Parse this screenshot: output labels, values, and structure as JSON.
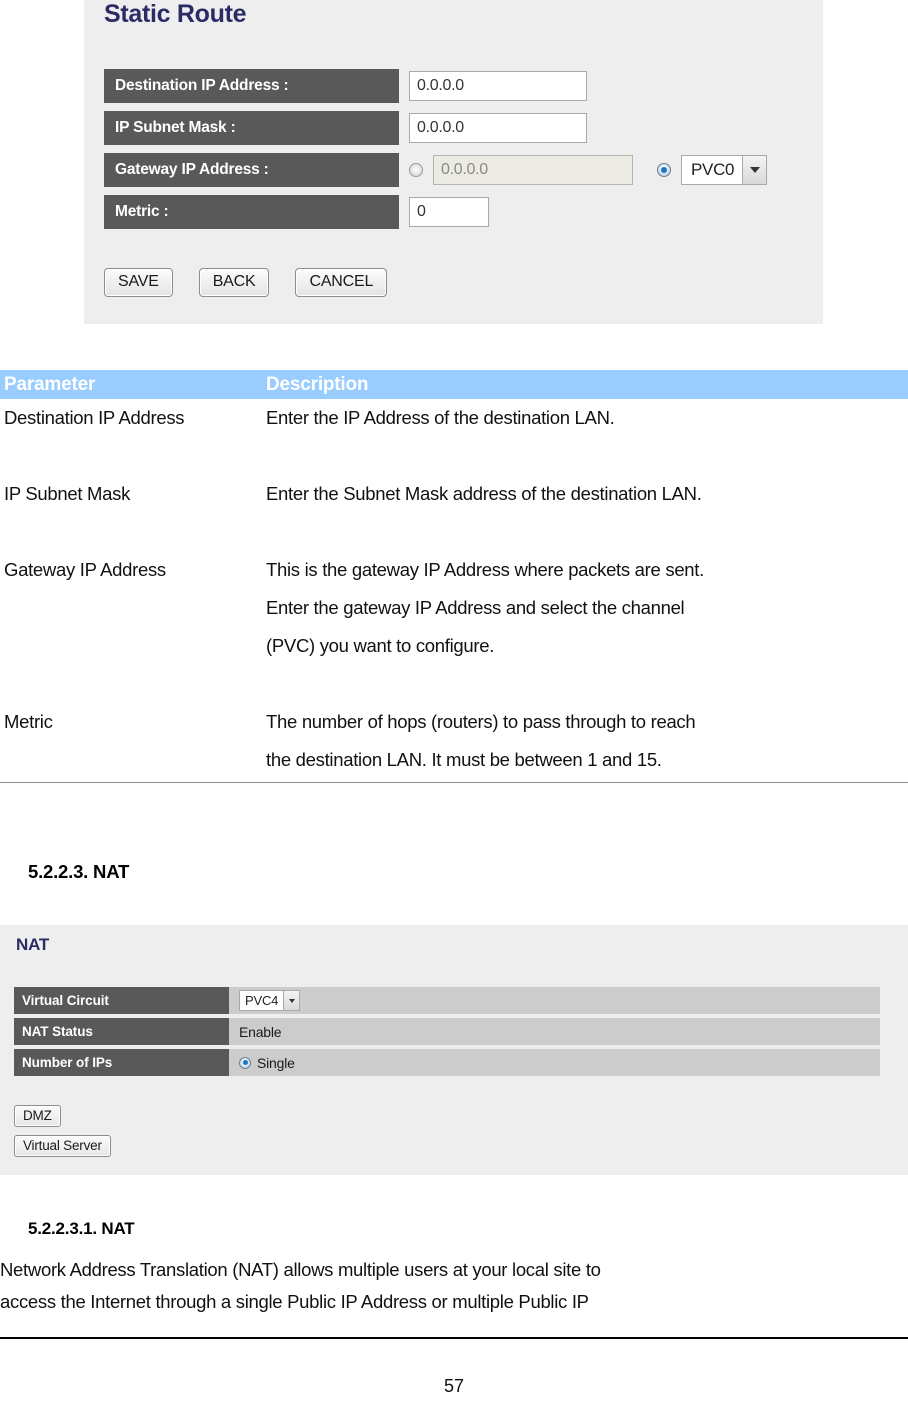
{
  "static_route_panel": {
    "title": "Static Route",
    "rows": [
      {
        "label": "Destination IP Address :",
        "value": "0.0.0.0"
      },
      {
        "label": "IP Subnet Mask :",
        "value": "0.0.0.0"
      },
      {
        "label": "Gateway IP Address :",
        "value": "0.0.0.0",
        "pvc_selected": "PVC0"
      },
      {
        "label": "Metric :",
        "value": "0"
      }
    ],
    "gateway_ip_radio_checked": false,
    "gateway_pvc_radio_checked": true,
    "buttons": [
      "SAVE",
      "BACK",
      "CANCEL"
    ]
  },
  "param_table": {
    "header": {
      "parameter": "Parameter",
      "description": "Description"
    },
    "rows": [
      {
        "parameter": "Destination IP Address",
        "description": [
          "Enter the IP Address of the destination LAN."
        ]
      },
      {
        "parameter": "IP Subnet Mask",
        "description": [
          "Enter the Subnet Mask address of the destination LAN."
        ]
      },
      {
        "parameter": "Gateway IP Address",
        "description": [
          "This is the gateway IP Address where packets are sent.",
          "Enter the gateway IP Address and select the channel",
          "(PVC) you want to configure."
        ]
      },
      {
        "parameter": "Metric",
        "description": [
          "The number of hops (routers) to pass through to reach",
          "the destination LAN. It must be between 1 and 15."
        ]
      }
    ]
  },
  "section_nat": {
    "heading": "5.2.2.3. NAT"
  },
  "nat_panel": {
    "title": "NAT",
    "rows": [
      {
        "label": "Virtual Circuit",
        "value": "PVC4",
        "type": "select"
      },
      {
        "label": "NAT Status",
        "value": "Enable",
        "type": "text"
      },
      {
        "label": "Number of IPs",
        "value": "Single",
        "type": "radio"
      }
    ],
    "buttons": [
      "DMZ",
      "Virtual Server"
    ]
  },
  "section_nat_sub": {
    "heading": "5.2.2.3.1.  NAT",
    "paragraph": [
      "Network Address Translation (NAT) allows multiple users at your local site to",
      "access the Internet through a single Public IP Address or multiple Public IP"
    ]
  },
  "footer": {
    "page_number": "57"
  },
  "colors": {
    "panel_bg": "#eeeeee",
    "label_bg": "#595959",
    "table_header_bg": "#99ccff",
    "nat_value_bg": "#cccccc",
    "title_color": "#2b2b66",
    "radio_accent": "#1f74c4"
  }
}
